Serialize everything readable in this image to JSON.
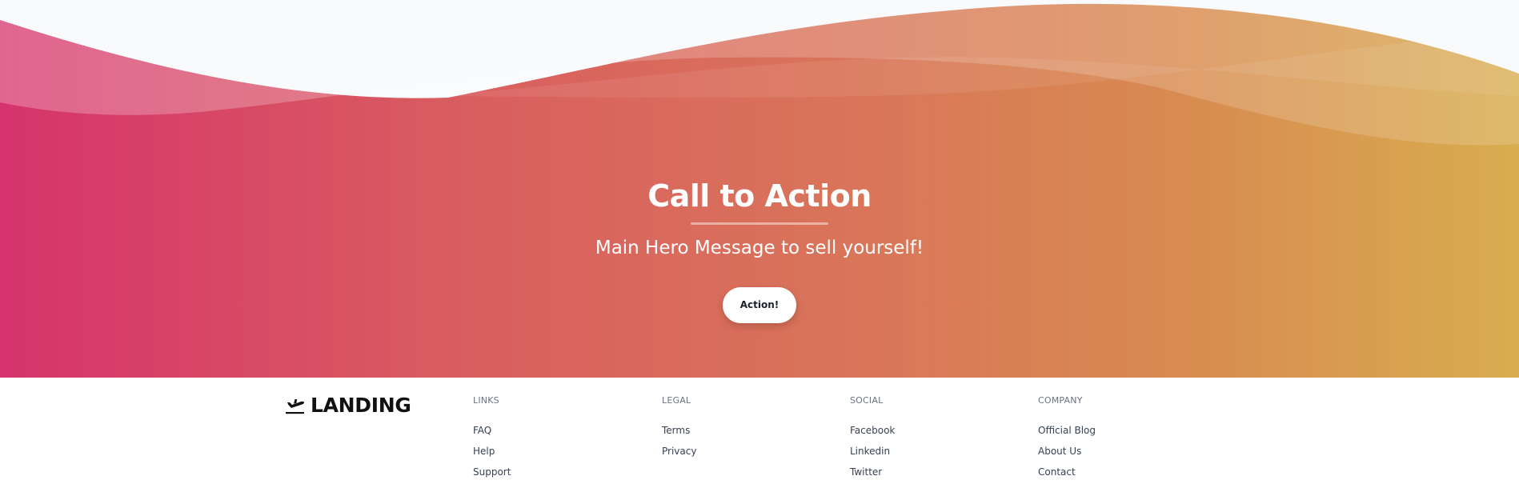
{
  "cta": {
    "title": "Call to Action",
    "subtitle": "Main Hero Message to sell yourself!",
    "button_label": "Action!"
  },
  "footer": {
    "brand": "LANDING",
    "columns": [
      {
        "heading": "Links",
        "items": [
          "FAQ",
          "Help",
          "Support"
        ]
      },
      {
        "heading": "Legal",
        "items": [
          "Terms",
          "Privacy"
        ]
      },
      {
        "heading": "Social",
        "items": [
          "Facebook",
          "Linkedin",
          "Twitter"
        ]
      },
      {
        "heading": "Company",
        "items": [
          "Official Blog",
          "About Us",
          "Contact"
        ]
      }
    ]
  },
  "colors": {
    "gradient_start": "#d6336c",
    "gradient_end": "#d8ad4f",
    "wave_bg": "#f8fafc",
    "button_bg": "#ffffff",
    "text_dark": "#1a202c"
  },
  "icons": {
    "brand": "airplane-takeoff-icon"
  }
}
